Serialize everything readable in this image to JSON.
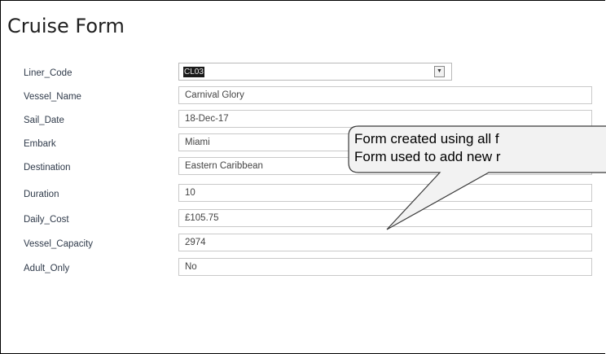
{
  "form": {
    "title": "Cruise Form",
    "fields": [
      {
        "label": "Liner_Code",
        "value": "CL03"
      },
      {
        "label": "Vessel_Name",
        "value": "Carnival Glory"
      },
      {
        "label": "Sail_Date",
        "value": "18-Dec-17"
      },
      {
        "label": "Embark",
        "value": "Miami"
      },
      {
        "label": "Destination",
        "value": "Eastern Caribbean"
      },
      {
        "label": "Duration",
        "value": "10"
      },
      {
        "label": "Daily_Cost",
        "value": "£105.75"
      },
      {
        "label": "Vessel_Capacity",
        "value": "2974"
      },
      {
        "label": "Adult_Only",
        "value": "No"
      }
    ],
    "dropdown_icon": "chevron-down-icon"
  },
  "callout": {
    "line1": "Form created using all f",
    "line2": "Form used to add new r"
  }
}
